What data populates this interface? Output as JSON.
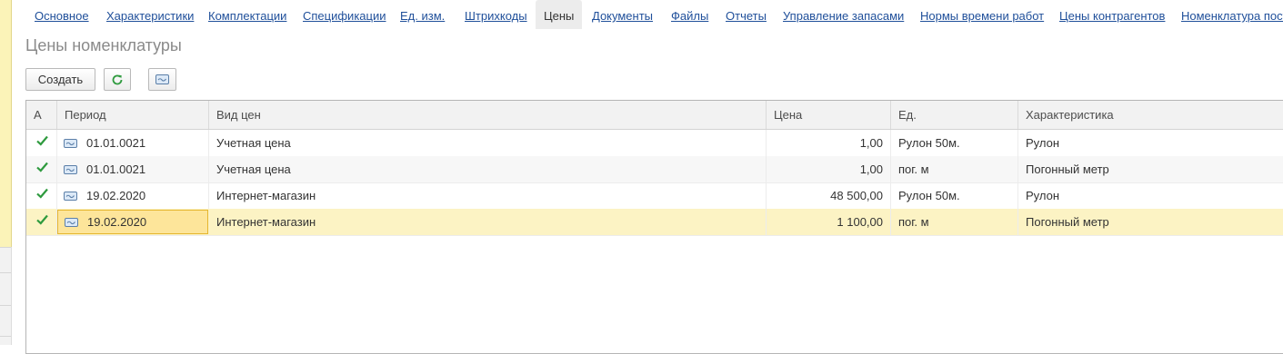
{
  "tabs": [
    {
      "label": "Основное",
      "active": false
    },
    {
      "label": "Характеристики",
      "active": false
    },
    {
      "label": "Комплектации",
      "active": false
    },
    {
      "label": "Спецификации",
      "active": false
    },
    {
      "label": "Ед. изм.",
      "active": false
    },
    {
      "label": "Штрихкоды",
      "active": false
    },
    {
      "label": "Цены",
      "active": true
    },
    {
      "label": "Документы",
      "active": false
    },
    {
      "label": "Файлы",
      "active": false
    },
    {
      "label": "Отчеты",
      "active": false
    },
    {
      "label": "Управление запасами",
      "active": false
    },
    {
      "label": "Нормы времени работ",
      "active": false
    },
    {
      "label": "Цены контрагентов",
      "active": false
    },
    {
      "label": "Номенклатура пост",
      "active": false
    }
  ],
  "page": {
    "title": "Цены номенклатуры"
  },
  "toolbar": {
    "create_label": "Создать",
    "refresh_icon": "refresh-icon",
    "extra_icon": "record-icon"
  },
  "table": {
    "columns": [
      "А",
      "Период",
      "Вид цен",
      "Цена",
      "Ед.",
      "Характеристика"
    ],
    "rows": [
      {
        "active": true,
        "period": "01.01.0021",
        "price_type": "Учетная цена",
        "price": "1,00",
        "unit": "Рулон 50м.",
        "characteristic": "Рулон"
      },
      {
        "active": true,
        "period": "01.01.0021",
        "price_type": "Учетная цена",
        "price": "1,00",
        "unit": "пог. м",
        "characteristic": "Погонный метр"
      },
      {
        "active": true,
        "period": "19.02.2020",
        "price_type": "Интернет-магазин",
        "price": "48 500,00",
        "unit": "Рулон 50м.",
        "characteristic": "Рулон"
      },
      {
        "active": true,
        "period": "19.02.2020",
        "price_type": "Интернет-магазин",
        "price": "1 100,00",
        "unit": "пог. м",
        "characteristic": "Погонный метр",
        "selected": true
      }
    ]
  },
  "colors": {
    "link": "#1f4f9a",
    "check": "#2e9a3e",
    "selected_row": "#fcf3c4",
    "focus_cell": "#fde59a"
  }
}
